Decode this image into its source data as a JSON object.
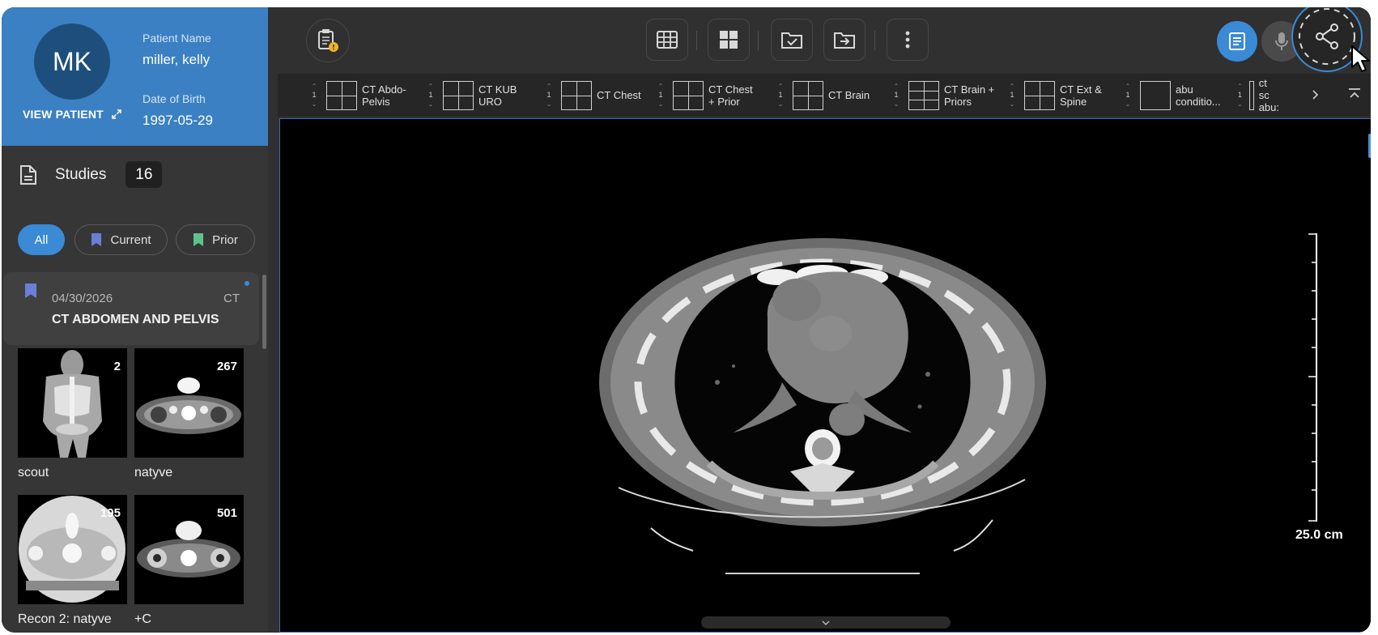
{
  "patient": {
    "initials": "MK",
    "name_label": "Patient Name",
    "name": "miller, kelly",
    "dob_label": "Date of Birth",
    "dob": "1997-05-29",
    "view_link": "VIEW PATIENT"
  },
  "studies": {
    "title": "Studies",
    "count": "16",
    "filters": [
      "All",
      "Current",
      "Prior"
    ],
    "current_study": {
      "date": "04/30/2026",
      "modality": "CT",
      "name": "CT ABDOMEN AND PELVIS"
    },
    "series": [
      {
        "label": "scout",
        "count": "2"
      },
      {
        "label": "natyve",
        "count": "267"
      },
      {
        "label": "Recon 2: natyve",
        "count": "195"
      },
      {
        "label": "+C",
        "count": "501"
      }
    ]
  },
  "toolbar": {
    "icons": [
      "clipboard-alert-icon",
      "grid-layout-icon",
      "quad-view-icon",
      "folder-check-icon",
      "folder-export-icon",
      "more-vertical-icon",
      "report-icon",
      "microphone-icon",
      "share-icon"
    ]
  },
  "hanging_protocols": [
    {
      "num": "1",
      "label": "CT Abdo-\nPelvis"
    },
    {
      "num": "1",
      "label": "CT KUB\nURO"
    },
    {
      "num": "1",
      "label": "CT Chest"
    },
    {
      "num": "1",
      "label": "CT Chest\n+ Prior"
    },
    {
      "num": "1",
      "label": "CT Brain"
    },
    {
      "num": "1",
      "label": "CT Brain +\nPriors"
    },
    {
      "num": "1",
      "label": "CT Ext &\nSpine"
    },
    {
      "num": "1",
      "label": "abu\nconditio..."
    },
    {
      "num": "1",
      "label": "ct sc\nabu:"
    }
  ],
  "viewport": {
    "scale_label": "25.0 cm"
  },
  "colors": {
    "accent": "#3a8ad6",
    "patient_header": "#3a80c3",
    "current_tag": "#6b7fd7",
    "prior_tag": "#5dc38d"
  }
}
